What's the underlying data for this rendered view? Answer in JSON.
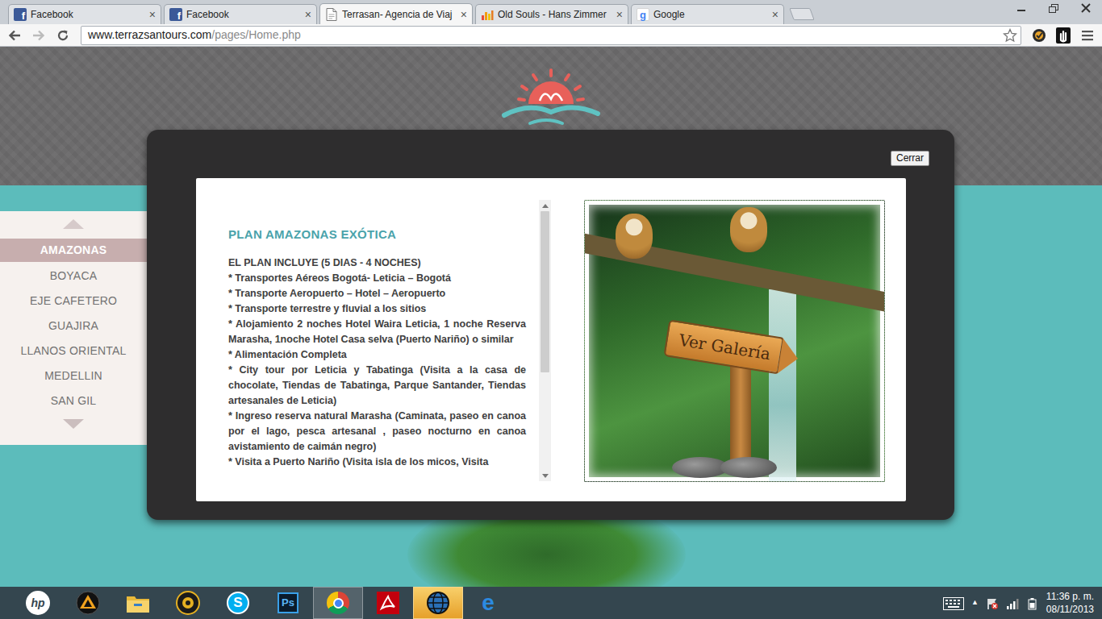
{
  "browser": {
    "tabs": [
      {
        "label": "Facebook",
        "selected": false,
        "kind": "facebook",
        "icon_text": "f"
      },
      {
        "label": "Facebook",
        "selected": false,
        "kind": "facebook",
        "icon_text": "f"
      },
      {
        "label": "Terrasan- Agencia de Viaj",
        "selected": true,
        "kind": "page"
      },
      {
        "label": "Old Souls - Hans Zimmer",
        "selected": false,
        "kind": "music"
      },
      {
        "label": "Google",
        "selected": false,
        "kind": "google",
        "icon_text": "g"
      }
    ],
    "tab_close": "×",
    "address_host": "www.terrazsantours.com",
    "address_path": "/pages/Home.php"
  },
  "site": {
    "menu": [
      {
        "label": "AMAZONAS",
        "selected": true
      },
      {
        "label": "BOYACA",
        "selected": false
      },
      {
        "label": "EJE CAFETERO",
        "selected": false
      },
      {
        "label": "GUAJIRA",
        "selected": false
      },
      {
        "label": "LLANOS ORIENTAL",
        "selected": false
      },
      {
        "label": "MEDELLIN",
        "selected": false
      },
      {
        "label": "SAN GIL",
        "selected": false
      }
    ],
    "modal": {
      "close": "Cerrar",
      "title": "PLAN AMAZONAS EXÓTICA",
      "intro": "EL PLAN INCLUYE (5 DIAS - 4 NOCHES)",
      "items": [
        "* Transportes Aéreos Bogotá- Leticia – Bogotá",
        "* Transporte Aeropuerto – Hotel – Aeropuerto",
        "* Transporte terrestre y fluvial a los sitios",
        "* Alojamiento 2 noches Hotel Waira Leticia, 1 noche Reserva Marasha, 1noche Hotel Casa selva (Puerto Nariño) o similar",
        "* Alimentación Completa",
        "* City tour por Leticia y Tabatinga (Visita a la casa de chocolate, Tiendas de Tabatinga, Parque Santander, Tiendas artesanales de Leticia)",
        "* Ingreso reserva natural Marasha (Caminata, paseo en canoa por el lago, pesca artesanal , paseo nocturno en canoa avistamiento de caimán negro)",
        "* Visita a Puerto Nariño (Visita isla de los micos, Visita"
      ],
      "gallery": "Ver Galería"
    }
  },
  "taskbar": {
    "apps": [
      {
        "kind": "hp",
        "label": "hp",
        "active": false
      },
      {
        "kind": "triangle",
        "active": false
      },
      {
        "kind": "explorer",
        "active": false
      },
      {
        "kind": "media",
        "active": false
      },
      {
        "kind": "skype",
        "label": "S",
        "active": false
      },
      {
        "kind": "photoshop",
        "label": "Ps",
        "active": false
      },
      {
        "kind": "chrome",
        "active": true
      },
      {
        "kind": "acrobat",
        "active": false
      },
      {
        "kind": "globe",
        "active": true
      },
      {
        "kind": "ie",
        "label": "e",
        "active": false
      }
    ],
    "tray_arrow": "▲",
    "time": "11:36 p. m.",
    "date": "08/11/2013"
  }
}
